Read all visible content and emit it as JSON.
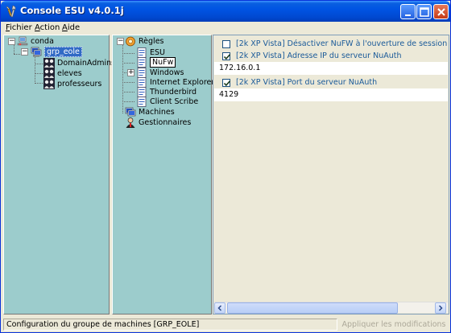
{
  "window": {
    "title": "Console ESU v4.0.1j"
  },
  "menubar": {
    "items": [
      {
        "label": "Fichier"
      },
      {
        "label": "Action"
      },
      {
        "label": "Aide"
      }
    ]
  },
  "groups_tree": {
    "root": "conda",
    "selected_group": "grp_eole",
    "children": [
      "DomainAdmins",
      "eleves",
      "professeurs"
    ]
  },
  "rules_tree": {
    "root": "Règles",
    "items": [
      "ESU",
      "NuFw",
      "Windows",
      "Internet Explorer",
      "Thunderbird",
      "Client Scribe"
    ],
    "selected": "NuFw",
    "machines": "Machines",
    "gestionnaires": "Gestionnaires"
  },
  "settings": [
    {
      "label": "[2k XP Vista] Désactiver NuFW à l'ouverture de session",
      "checked": false
    },
    {
      "label": "[2k XP Vista] Adresse IP du serveur NuAuth",
      "checked": true,
      "value": "172.16.0.1"
    },
    {
      "label": "[2k XP Vista] Port du serveur NuAuth",
      "checked": true,
      "value": "4129"
    }
  ],
  "statusbar": {
    "text": "Configuration du groupe de machines [GRP_EOLE]",
    "apply_label": "Appliquer les modifications"
  },
  "colors": {
    "pane_bg": "#9ccccc",
    "title_bar": "#0054e3",
    "setting_text": "#1a5a99"
  }
}
